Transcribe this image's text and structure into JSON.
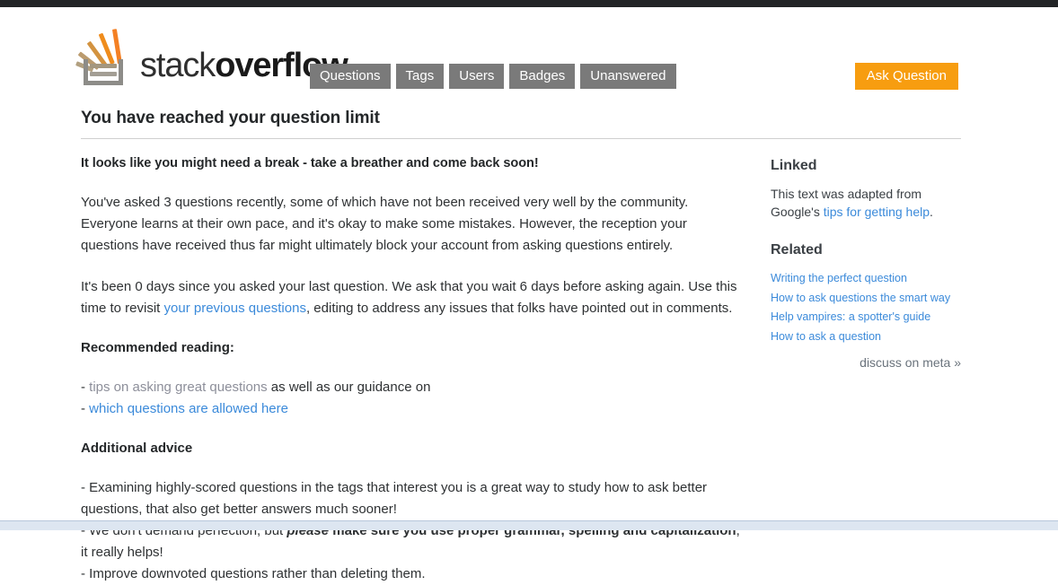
{
  "header": {
    "logo_text_light": "stack",
    "logo_text_bold": "overflow",
    "logo_icon": "stackoverflow-logo-icon",
    "nav": [
      {
        "label": "Questions",
        "name": "nav-questions"
      },
      {
        "label": "Tags",
        "name": "nav-tags"
      },
      {
        "label": "Users",
        "name": "nav-users"
      },
      {
        "label": "Badges",
        "name": "nav-badges"
      },
      {
        "label": "Unanswered",
        "name": "nav-unanswered"
      }
    ],
    "ask_button": "Ask Question"
  },
  "main": {
    "title": "You have reached your question limit",
    "lead": "It looks like you might need a break - take a breather and come back soon!",
    "paragraph_1": "You've asked 3 questions recently, some of which have not been received very well by the community. Everyone learns at their own pace, and it's okay to make some mistakes. However, the reception your questions have received thus far might ultimately block your account from asking questions entirely.",
    "paragraph_2_part1": "It's been 0 days since you asked your last question. We ask that you wait 6 days before asking again. Use this time to revisit ",
    "paragraph_2_link": "your previous questions",
    "paragraph_2_part2": ", editing to address any issues that folks have pointed out in comments.",
    "recommended_heading": "Recommended reading:",
    "bullet_1_dash": "- ",
    "bullet_1_link": "tips on asking great questions",
    "bullet_1_rest": " as well as our guidance on",
    "bullet_2_dash": "- ",
    "bullet_2_link": "which questions are allowed here",
    "additional_heading": "Additional advice",
    "advice_1": "- Examining highly-scored questions in the tags that interest you is a great way to study how to ask better questions, that also get better answers much sooner!",
    "advice_2_part1": "- We don't demand perfection, but ",
    "advice_2_emph": "please",
    "advice_2_bold": " make sure you use proper grammar, spelling and capitalization",
    "advice_2_part2": ", it really helps!",
    "advice_3": "- Improve downvoted questions rather than deleting them.",
    "stats": {
      "questions_asked_recently": 3,
      "days_since_last_question": 0,
      "wait_days_required": 6
    }
  },
  "sidebar": {
    "linked_heading": "Linked",
    "linked_text_part1": "This text was adapted from Google's ",
    "linked_link": "tips for getting help",
    "linked_text_part2": ".",
    "related_heading": "Related",
    "related_links": [
      "Writing the perfect question",
      "How to ask questions the smart way",
      "Help vampires: a spotter's guide",
      "How to ask a question"
    ],
    "meta_link": "discuss on meta »"
  },
  "colors": {
    "accent_orange": "#f79d10",
    "logo_orange": "#f48024",
    "nav_gray": "#7a7a7a",
    "link_blue": "#3b8ada",
    "visited_link": "#8d8f9a",
    "top_strip": "#222426",
    "footer_band": "#dde6f1"
  }
}
